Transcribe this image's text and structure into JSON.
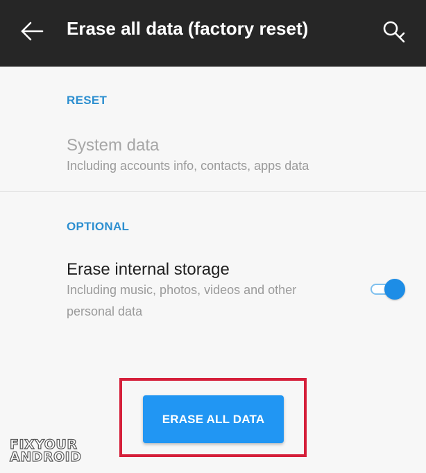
{
  "appbar": {
    "title": "Erase all data (factory reset)",
    "back_icon": "arrow-left-icon",
    "search_icon": "search-icon",
    "background_color": "#262626"
  },
  "sections": {
    "reset": {
      "header": "RESET",
      "item": {
        "title": "System data",
        "subtitle": "Including accounts info, contacts, apps data"
      }
    },
    "optional": {
      "header": "OPTIONAL",
      "item": {
        "title": "Erase internal storage",
        "subtitle_line1": "Including music, photos, videos and other",
        "subtitle_line2": "personal data",
        "toggle_on": true
      }
    }
  },
  "action": {
    "erase_label": "ERASE ALL DATA",
    "button_color": "#2196f3",
    "highlight_color": "#d51f3a"
  },
  "watermark": {
    "line1": "FIXYOUR",
    "line2": "ANDROID"
  },
  "accent_color": "#2d8fd0"
}
